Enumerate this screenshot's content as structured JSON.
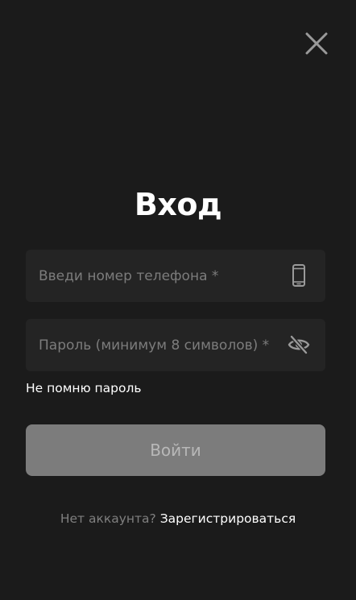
{
  "header": {
    "close_icon": "close-icon"
  },
  "title": "Вход",
  "phone_field": {
    "placeholder": "Введи номер телефона *",
    "value": "",
    "icon": "smartphone-icon"
  },
  "password_field": {
    "placeholder": "Пароль (минимум 8 символов) *",
    "value": "",
    "icon": "eye-off-icon"
  },
  "forgot_password": "Не помню пароль",
  "login_button": "Войти",
  "signup": {
    "prompt": "Нет аккаунта?",
    "link": "Зарегистрироваться"
  },
  "colors": {
    "background": "#1b1b1b",
    "field_background": "#242424",
    "button_disabled": "#7c7c7c",
    "text_primary": "#ffffff",
    "text_muted": "#7f7f7f"
  }
}
